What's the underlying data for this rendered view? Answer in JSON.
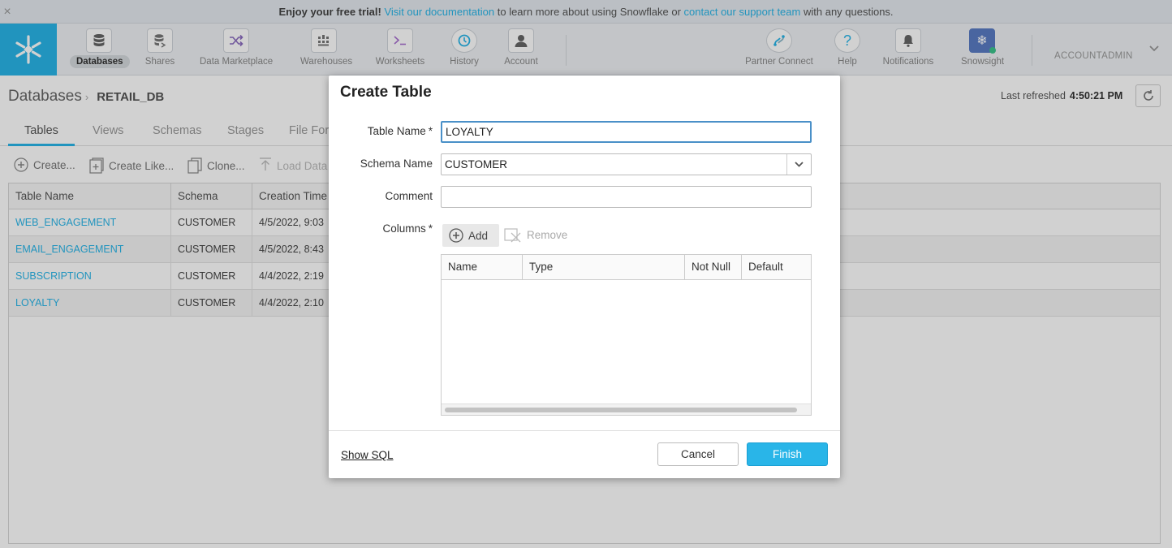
{
  "banner": {
    "lead": "Enjoy your free trial!",
    "link1": "Visit our documentation",
    "mid": "to learn more about using Snowflake or",
    "link2": "contact our support team",
    "tail": "with any questions.",
    "close": "×"
  },
  "nav": {
    "items": [
      {
        "label": "Databases",
        "icon": "database-icon"
      },
      {
        "label": "Shares",
        "icon": "shares-icon"
      },
      {
        "label": "Data Marketplace",
        "icon": "shuffle-icon"
      },
      {
        "label": "Warehouses",
        "icon": "warehouse-icon"
      },
      {
        "label": "Worksheets",
        "icon": "terminal-icon"
      },
      {
        "label": "History",
        "icon": "history-icon"
      },
      {
        "label": "Account",
        "icon": "person-icon"
      },
      {
        "label": "Partner Connect",
        "icon": "partner-connect-icon"
      },
      {
        "label": "Help",
        "icon": "help-icon"
      },
      {
        "label": "Notifications",
        "icon": "bell-icon"
      },
      {
        "label": "Snowsight",
        "icon": "snowsight-icon"
      }
    ],
    "account": "ACCOUNTADMIN"
  },
  "page": {
    "breadcrumb_root": "Databases",
    "breadcrumb_db": "RETAIL_DB",
    "last_refreshed_label": "Last refreshed",
    "last_refreshed_time": "4:50:21 PM",
    "tabs": [
      "Tables",
      "Views",
      "Schemas",
      "Stages",
      "File For"
    ],
    "toolbar": [
      "Create...",
      "Create Like...",
      "Clone...",
      "Load Data"
    ],
    "table_headers": [
      "Table Name",
      "Schema",
      "Creation Time"
    ],
    "rows": [
      {
        "name": "WEB_ENGAGEMENT",
        "schema": "CUSTOMER",
        "created": "4/5/2022, 9:03"
      },
      {
        "name": "EMAIL_ENGAGEMENT",
        "schema": "CUSTOMER",
        "created": "4/5/2022, 8:43"
      },
      {
        "name": "SUBSCRIPTION",
        "schema": "CUSTOMER",
        "created": "4/4/2022, 2:19"
      },
      {
        "name": "LOYALTY",
        "schema": "CUSTOMER",
        "created": "4/4/2022, 2:10"
      }
    ]
  },
  "modal": {
    "title": "Create Table",
    "table_name_label": "Table Name",
    "table_name_value": "LOYALTY",
    "schema_label": "Schema Name",
    "schema_value": "CUSTOMER",
    "comment_label": "Comment",
    "comment_value": "",
    "columns_label": "Columns",
    "required_mark": "*",
    "add_label": "Add",
    "remove_label": "Remove",
    "column_headers": [
      "Name",
      "Type",
      "Not Null",
      "Default"
    ],
    "show_sql": "Show SQL",
    "cancel": "Cancel",
    "finish": "Finish"
  },
  "colors": {
    "accent": "#29b5e8",
    "link": "#29b5e8"
  }
}
